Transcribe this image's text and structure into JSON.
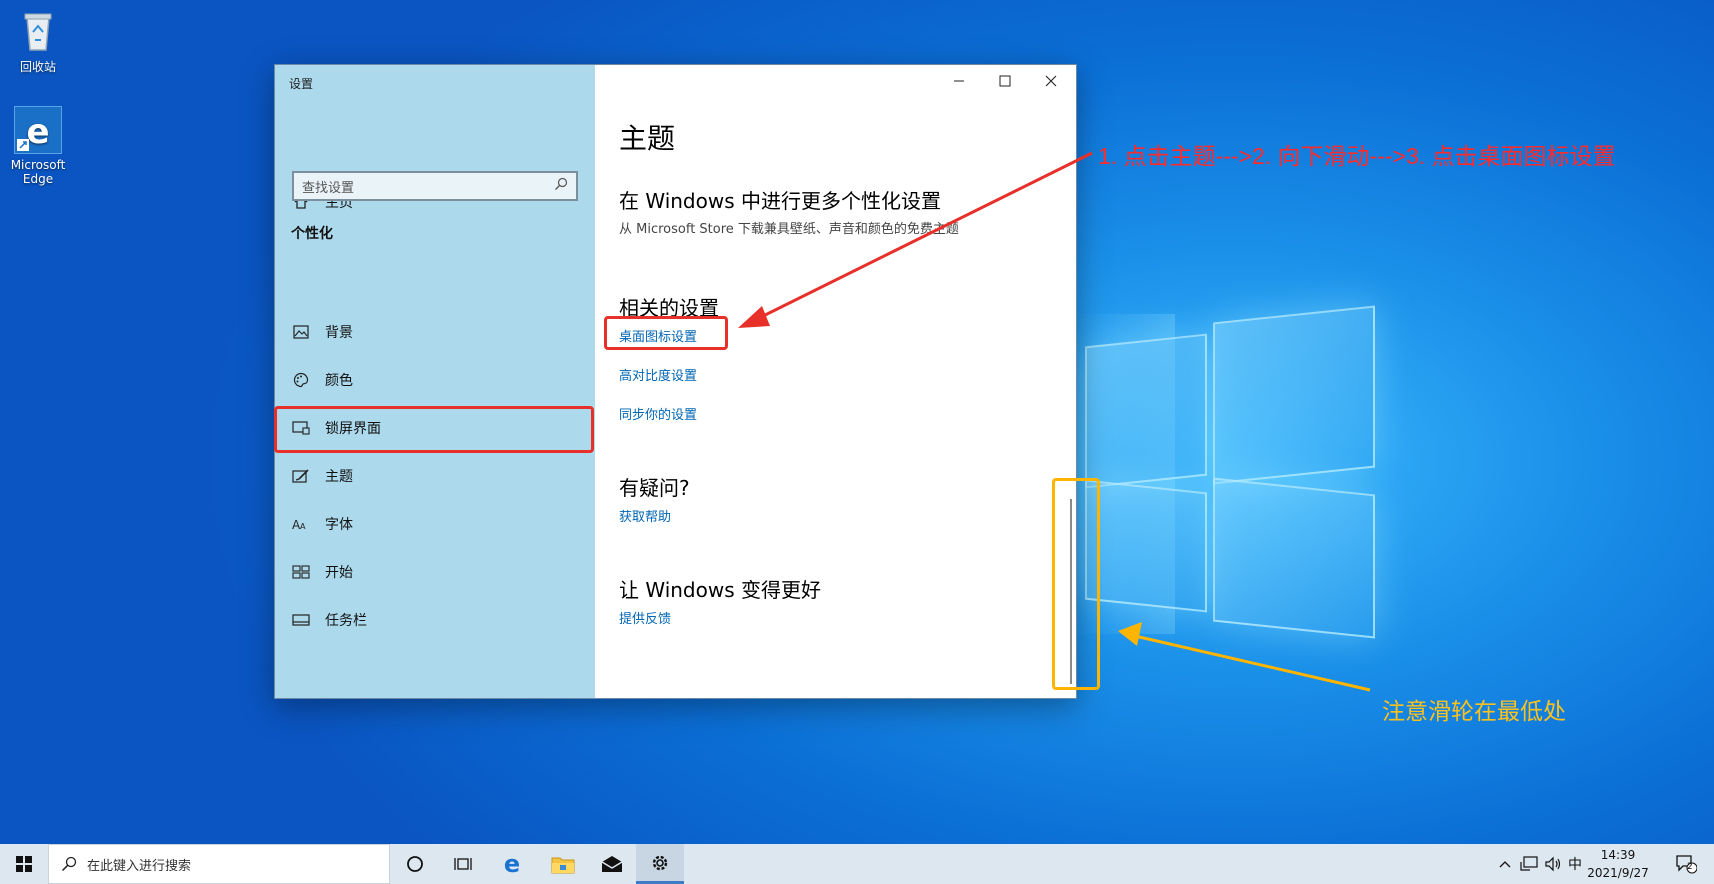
{
  "desktop": {
    "icons": [
      {
        "label": "回收站",
        "icon": "recycle-bin-icon"
      },
      {
        "label": "Microsoft Edge",
        "icon": "edge-icon"
      }
    ]
  },
  "window": {
    "title": "设置",
    "controls": {
      "minimize": "minimize-icon",
      "maximize": "maximize-icon",
      "close": "close-icon"
    }
  },
  "sidebar": {
    "home": "主页",
    "search_placeholder": "查找设置",
    "category": "个性化",
    "items": [
      {
        "label": "背景",
        "icon": "image-icon"
      },
      {
        "label": "颜色",
        "icon": "palette-icon"
      },
      {
        "label": "锁屏界面",
        "icon": "lock-screen-icon"
      },
      {
        "label": "主题",
        "icon": "theme-icon",
        "selected": true
      },
      {
        "label": "字体",
        "icon": "font-icon"
      },
      {
        "label": "开始",
        "icon": "start-layout-icon"
      },
      {
        "label": "任务栏",
        "icon": "taskbar-icon"
      }
    ]
  },
  "main": {
    "title": "主题",
    "more_heading": "在 Windows 中进行更多个性化设置",
    "more_sub": "从 Microsoft Store 下载兼具壁纸、声音和颜色的免费主题",
    "related_heading": "相关的设置",
    "related_links": [
      "桌面图标设置",
      "高对比度设置",
      "同步你的设置"
    ],
    "question_heading": "有疑问?",
    "help_link": "获取帮助",
    "improve_heading": "让 Windows 变得更好",
    "feedback_link": "提供反馈"
  },
  "annotations": {
    "red_text": "1. 点击主题--->2. 向下滑动--->3. 点击桌面图标设置",
    "yellow_text": "注意滑轮在最低处",
    "red_color": "#e8302a",
    "yellow_color": "#ffb400"
  },
  "taskbar": {
    "search_placeholder": "在此键入进行搜索",
    "apps": [
      "cortana-icon",
      "task-view-icon",
      "edge-icon",
      "file-explorer-icon",
      "mail-icon",
      "settings-icon"
    ],
    "tray": {
      "ime": "中",
      "time": "14:39",
      "date": "2021/9/27",
      "notification_count": "2"
    }
  }
}
